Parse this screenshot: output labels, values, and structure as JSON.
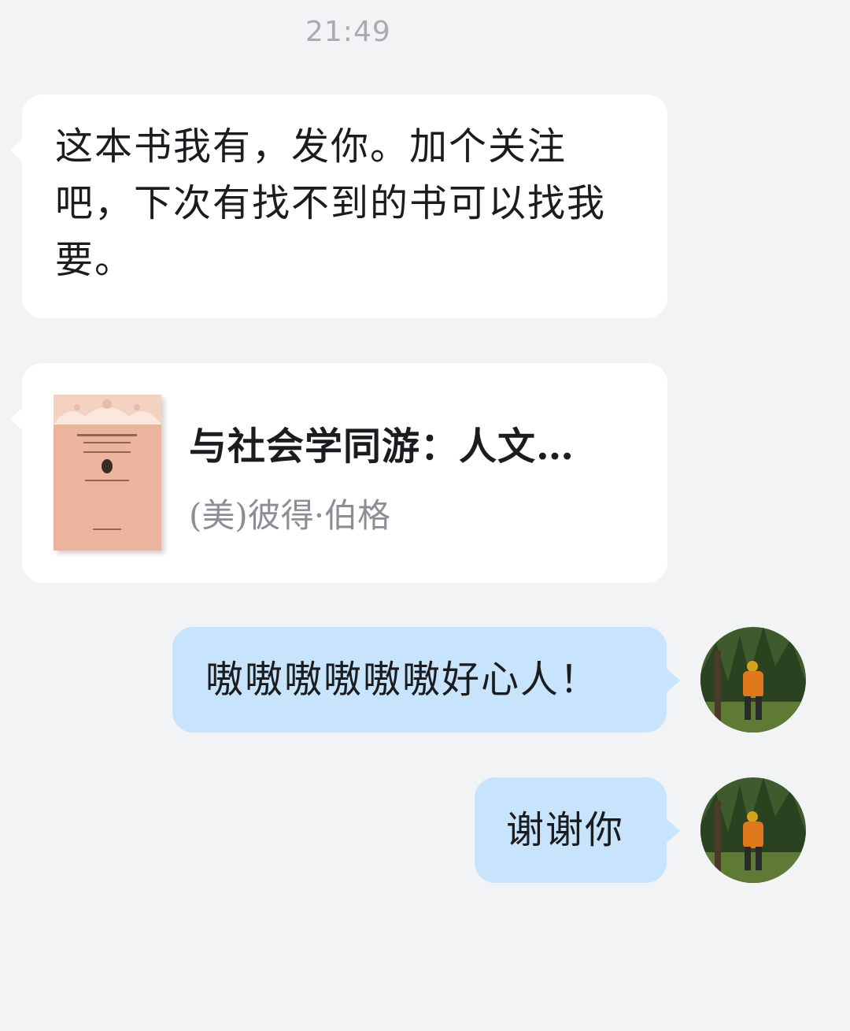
{
  "chat": {
    "timestamp": "21:49",
    "messages": [
      {
        "sender": "other",
        "type": "text",
        "text": "这本书我有，发你。加个关注吧，下次有找不到的书可以找我要。"
      },
      {
        "sender": "other",
        "type": "book_card",
        "title": "与社会学同游：人文…",
        "author": "(美)彼得·伯格",
        "cover_color": "#eab59c"
      },
      {
        "sender": "self",
        "type": "text",
        "text": "嗷嗷嗷嗷嗷嗷好心人！"
      },
      {
        "sender": "self",
        "type": "text",
        "text": "谢谢你"
      }
    ]
  },
  "colors": {
    "background": "#f2f3f5",
    "incoming_bubble": "#ffffff",
    "outgoing_bubble": "#c8e4fc",
    "timestamp_text": "#a9abb0"
  }
}
